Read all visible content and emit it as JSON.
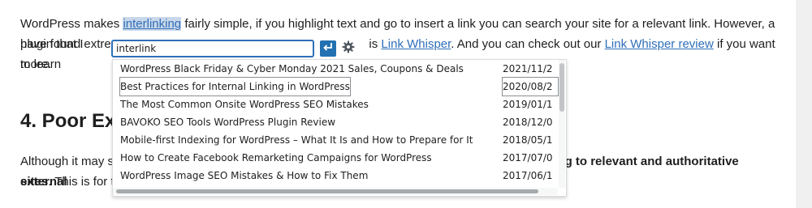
{
  "paragraph1": {
    "line1_pre": "WordPress makes ",
    "line1_selected": "interlinking",
    "line1_post": " fairly simple, if you highlight text and go to insert a link you can search your site for a relevant link. However, a plugin that I",
    "line2_pre": "have found extrem",
    "line2_mid": " is ",
    "line2_link1": "Link Whisper",
    "line2_mid2": ". And you can check out our ",
    "line2_link2": "Link Whisper review",
    "line2_post": " if you want to learn",
    "line3": "more."
  },
  "heading": {
    "text": "4. Poor Ext"
  },
  "paragraph2": {
    "line1_pre": "Although it may se",
    "line1_bold": "ng to relevant and authoritative external",
    "line2_bold": "sites",
    "line2_post": ". This is for tw"
  },
  "link_popover": {
    "search_value": "interlink",
    "apply_icon": "enter-arrow-icon",
    "settings_icon": "gear-icon",
    "accent_color": "#2271b1"
  },
  "results": [
    {
      "title": "WordPress Black Friday & Cyber Monday 2021 Sales, Coupons & Deals",
      "date": "2021/11/2"
    },
    {
      "title": "Best Practices for Internal Linking in WordPress",
      "date": "2020/08/2"
    },
    {
      "title": "The Most Common Onsite WordPress SEO Mistakes",
      "date": "2019/01/1"
    },
    {
      "title": "BAVOKO SEO Tools WordPress Plugin Review",
      "date": "2018/12/0"
    },
    {
      "title": "Mobile-first Indexing for WordPress – What It Is and How to Prepare for It",
      "date": "2018/05/1"
    },
    {
      "title": "How to Create Facebook Remarketing Campaigns for WordPress",
      "date": "2017/07/0"
    },
    {
      "title": "WordPress Image SEO Mistakes & How to Fix Them",
      "date": "2017/06/1"
    }
  ]
}
